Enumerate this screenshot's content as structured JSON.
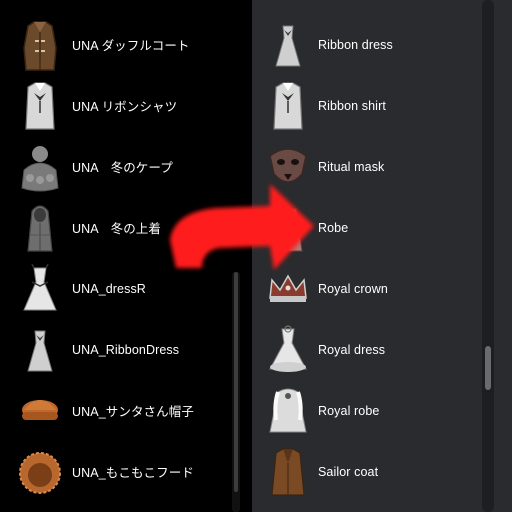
{
  "left_list": {
    "items": [
      {
        "label": "UNA ダッフルコート",
        "icon": "duffle-coat-icon",
        "color": "#6b4a2b"
      },
      {
        "label": "UNA リボンシャツ",
        "icon": "ribbon-shirt-icon",
        "color": "#d8d8d8"
      },
      {
        "label": "UNA　冬のケープ",
        "icon": "winter-cape-icon",
        "color": "#8a8a8a"
      },
      {
        "label": "UNA　冬の上着",
        "icon": "winter-coat-icon",
        "color": "#6e6e6e"
      },
      {
        "label": "UNA_dressR",
        "icon": "dress-icon",
        "color": "#e6e6e6"
      },
      {
        "label": "UNA_RibbonDress",
        "icon": "ribbon-dress-icon",
        "color": "#cfcfcf"
      },
      {
        "label": "UNA_サンタさん帽子",
        "icon": "santa-hat-icon",
        "color": "#c0672b"
      },
      {
        "label": "UNA_もこもこフード",
        "icon": "fluffy-hood-icon",
        "color": "#b8682e"
      }
    ]
  },
  "right_list": {
    "items": [
      {
        "label": "Ribbon dress",
        "icon": "ribbon-dress-icon",
        "color": "#cfcfcf"
      },
      {
        "label": "Ribbon shirt",
        "icon": "ribbon-shirt-icon",
        "color": "#d8d8d8"
      },
      {
        "label": "Ritual mask",
        "icon": "ritual-mask-icon",
        "color": "#6a4a44"
      },
      {
        "label": "Robe",
        "icon": "robe-icon",
        "color": "#b07a7a"
      },
      {
        "label": "Royal crown",
        "icon": "royal-crown-icon",
        "color": "#8a3b2e"
      },
      {
        "label": "Royal dress",
        "icon": "royal-dress-icon",
        "color": "#e6e6e6"
      },
      {
        "label": "Royal robe",
        "icon": "royal-robe-icon",
        "color": "#dcdcdc"
      },
      {
        "label": "Sailor coat",
        "icon": "sailor-coat-icon",
        "color": "#7a4a25"
      }
    ]
  },
  "overlay": {
    "icon": "red-arrow-icon",
    "color": "#ff1a1a"
  }
}
